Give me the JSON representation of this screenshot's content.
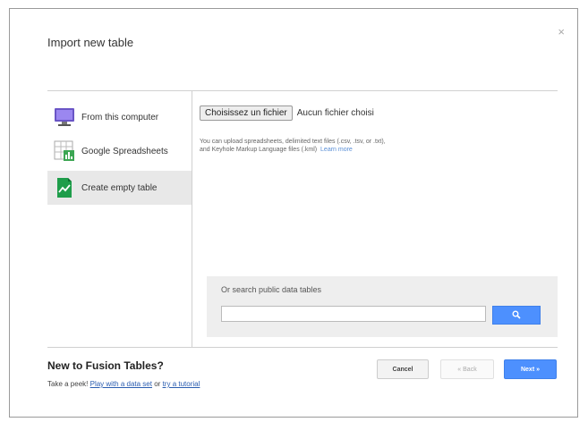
{
  "dialog": {
    "title": "Import new table",
    "close_label": "×"
  },
  "sidebar": {
    "items": [
      {
        "label": "From this computer",
        "icon": "monitor-icon"
      },
      {
        "label": "Google Spreadsheets",
        "icon": "spreadsheet-icon"
      },
      {
        "label": "Create empty table",
        "icon": "empty-table-icon",
        "selected": true
      }
    ]
  },
  "upload": {
    "choose_button": "Choisissez un fichier",
    "no_file_text": "Aucun fichier choisi",
    "hint_line1": "You can upload spreadsheets, delimited text files (.csv, .tsv, or .txt),",
    "hint_line2": "and Keyhole Markup Language files (.kml)",
    "learn_more": "Learn more"
  },
  "search": {
    "label": "Or search public data tables",
    "input_value": "",
    "button_icon": "search-icon"
  },
  "footer": {
    "title": "New to Fusion Tables?",
    "sub_prefix": "Take a peek!",
    "link1": "Play with a data set",
    "or_text": "or",
    "link2": "try a tutorial"
  },
  "buttons": {
    "cancel": "Cancel",
    "back": "« Back",
    "next": "Next »"
  },
  "colors": {
    "accent": "#4d90fe",
    "selected_bg": "#e8e8e8",
    "link": "#2a5db0"
  }
}
